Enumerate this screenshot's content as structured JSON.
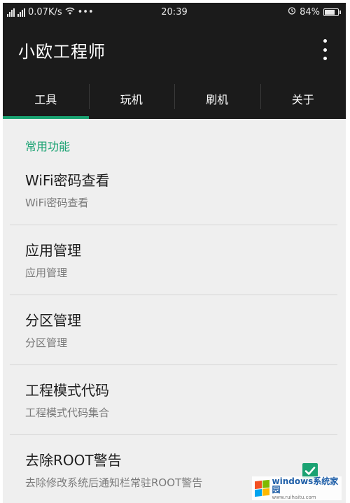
{
  "status_bar": {
    "net_left_1": "4G",
    "net_left_2": "4G",
    "speed": "0.07K/s",
    "more": "•••",
    "time": "20:39",
    "battery": "84%",
    "battery_level": 0.84
  },
  "app_bar": {
    "title": "小欧工程师"
  },
  "tabs": [
    {
      "label": "工具",
      "active": true
    },
    {
      "label": "玩机",
      "active": false
    },
    {
      "label": "刷机",
      "active": false
    },
    {
      "label": "关于",
      "active": false
    }
  ],
  "section": {
    "header": "常用功能"
  },
  "items": [
    {
      "title": "WiFi密码查看",
      "subtitle": "WiFi密码查看"
    },
    {
      "title": "应用管理",
      "subtitle": "应用管理"
    },
    {
      "title": "分区管理",
      "subtitle": "分区管理"
    },
    {
      "title": "工程模式代码",
      "subtitle": "工程模式代码集合"
    },
    {
      "title": "去除ROOT警告",
      "subtitle": "去除修改系统后通知栏常驻ROOT警告",
      "checked": true
    }
  ],
  "watermark": {
    "brand": "windows系统家园",
    "url": "www.ruihaitu.com"
  },
  "colors": {
    "accent": "#1aa272",
    "bar_bg": "#1b1b1b",
    "content_bg": "#efefef"
  }
}
